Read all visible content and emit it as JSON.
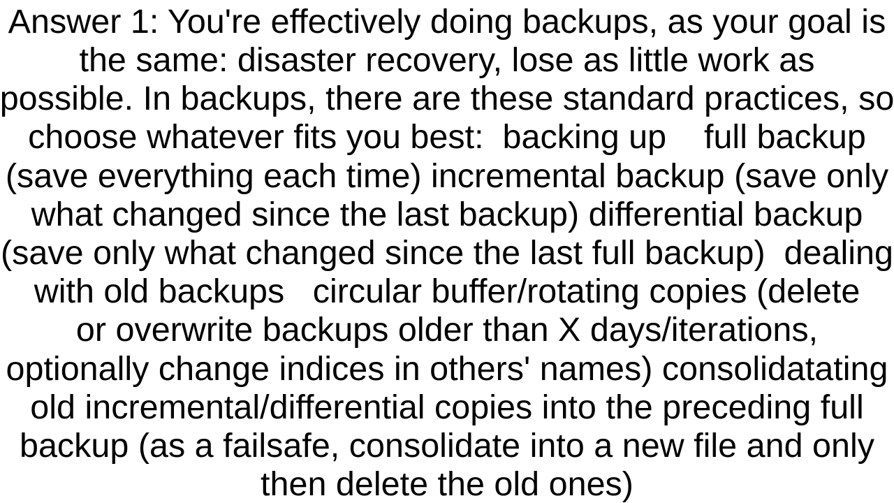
{
  "answer": {
    "lines": [
      "Answer 1: You're effectively doing backups, as your goal is",
      "the same: disaster recovery, lose as little work as",
      "possible. In backups, there are these standard practices, so",
      "choose whatever fits you best:  backing up    full backup",
      "(save everything each time) incremental backup (save only",
      "what changed since the last backup) differential backup",
      "(save only what changed since the last full backup)  dealing",
      "with old backups   circular buffer/rotating copies (delete",
      "or overwrite backups older than X days/iterations,",
      "optionally change indices in others' names) consolidatating",
      "old incremental/differential copies into the preceding full",
      "backup (as a failsafe, consolidate into a new file and only",
      "then delete the old ones)"
    ]
  }
}
